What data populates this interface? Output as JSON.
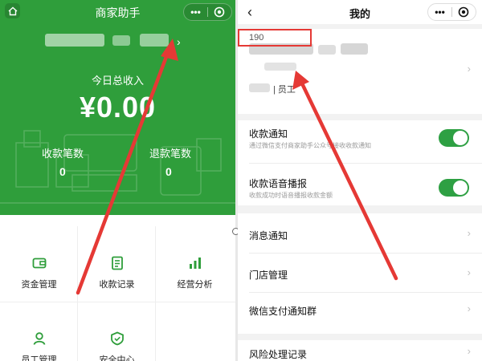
{
  "left": {
    "title": "商家助手",
    "income_label": "今日总收入",
    "income_value": "¥0.00",
    "stats": [
      {
        "label": "收款笔数",
        "value": "0"
      },
      {
        "label": "退款笔数",
        "value": "0"
      }
    ],
    "grid": [
      {
        "label": "资金管理",
        "icon": "wallet-icon"
      },
      {
        "label": "收款记录",
        "icon": "receipt-icon"
      },
      {
        "label": "经营分析",
        "icon": "bar-chart-icon"
      },
      {
        "label": "员工管理",
        "icon": "person-icon"
      },
      {
        "label": "安全中心",
        "icon": "shield-icon"
      }
    ]
  },
  "right": {
    "title": "我的",
    "phone_prefix": "190",
    "role": "| 员工",
    "rows": [
      {
        "title": "收款通知",
        "subtitle": "通过微信支付商家助手公众号接收收款通知",
        "toggle": true
      },
      {
        "title": "收款语音播报",
        "subtitle": "收款成功时语音播报收款金额",
        "toggle": true
      },
      {
        "title": "消息通知"
      },
      {
        "title": "门店管理"
      },
      {
        "title": "微信支付通知群"
      },
      {
        "title": "风险处理记录"
      }
    ]
  },
  "colors": {
    "brand_green": "#2f9e3b",
    "toggle_green": "#2ea043",
    "annotation_red": "#e53935"
  },
  "icons": {
    "more": "•••",
    "chevron": "›",
    "back": "‹"
  }
}
